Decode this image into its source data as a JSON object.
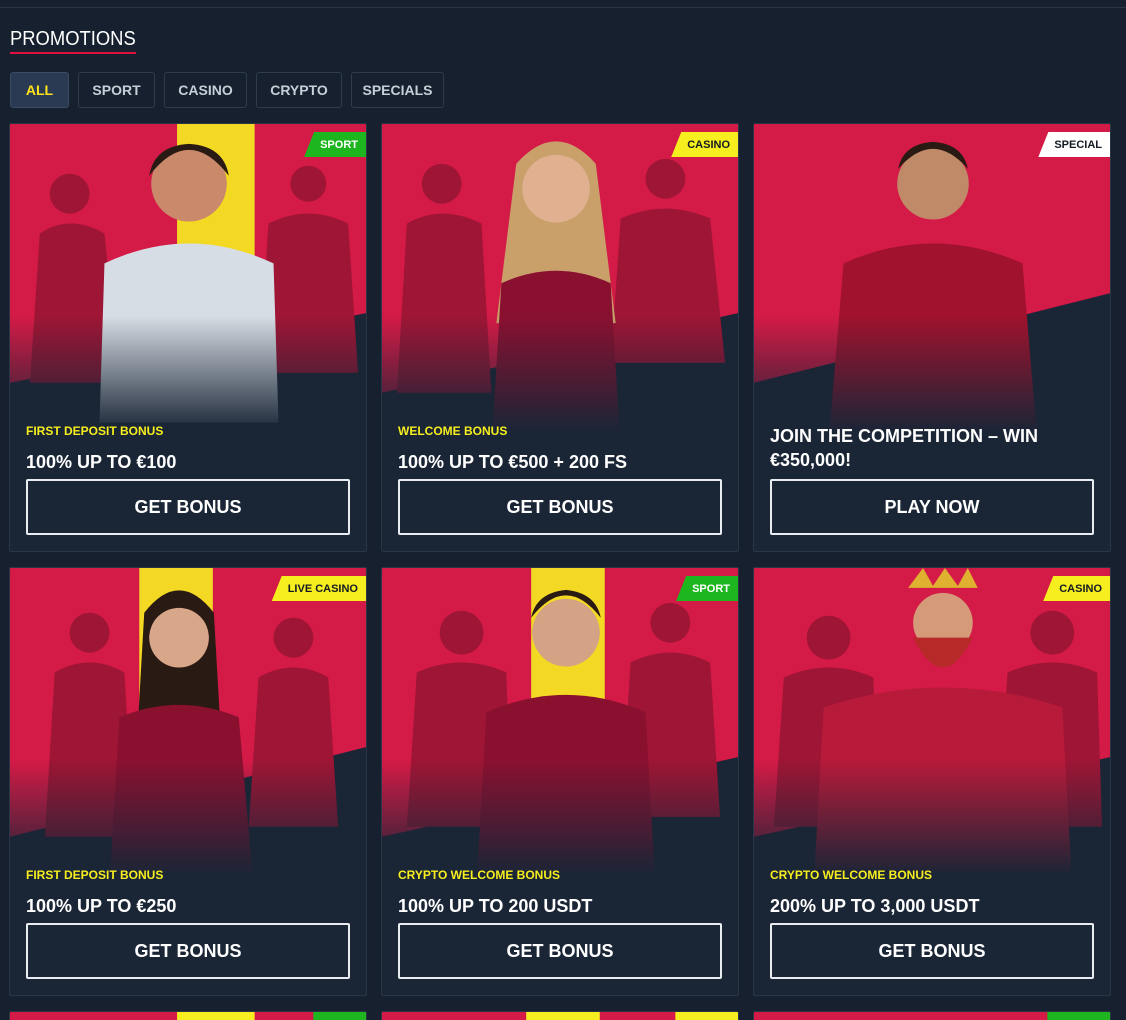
{
  "page": {
    "title": "PROMOTIONS"
  },
  "filters": [
    "ALL",
    "SPORT",
    "CASINO",
    "CRYPTO",
    "SPECIALS"
  ],
  "colors": {
    "accent_red": "#e3103f",
    "brand_yellow": "#f6ee1f",
    "tag_green": "#1db61e",
    "bg": "#16202e"
  },
  "cards": [
    {
      "tag": "SPORT",
      "tag_style": "green",
      "subtitle": "FIRST DEPOSIT BONUS",
      "headline": "100% UP TO €100",
      "cta": "GET BONUS"
    },
    {
      "tag": "CASINO",
      "tag_style": "yellow",
      "subtitle": "WELCOME BONUS",
      "headline": "100% UP TO €500 + 200 FS",
      "cta": "GET BONUS"
    },
    {
      "tag": "SPECIAL",
      "tag_style": "white",
      "subtitle": "",
      "headline": "JOIN THE COMPETITION – WIN €350,000!",
      "cta": "PLAY NOW"
    },
    {
      "tag": "LIVE CASINO",
      "tag_style": "yellow",
      "subtitle": "FIRST DEPOSIT BONUS",
      "headline": "100% UP TO €250",
      "cta": "GET BONUS"
    },
    {
      "tag": "SPORT",
      "tag_style": "green",
      "subtitle": "CRYPTO WELCOME BONUS",
      "headline": "100% UP TO 200 USDT",
      "cta": "GET BONUS"
    },
    {
      "tag": "CASINO",
      "tag_style": "yellow",
      "subtitle": "CRYPTO WELCOME BONUS",
      "headline": "200% UP TO 3,000 USDT",
      "cta": "GET BONUS"
    }
  ]
}
